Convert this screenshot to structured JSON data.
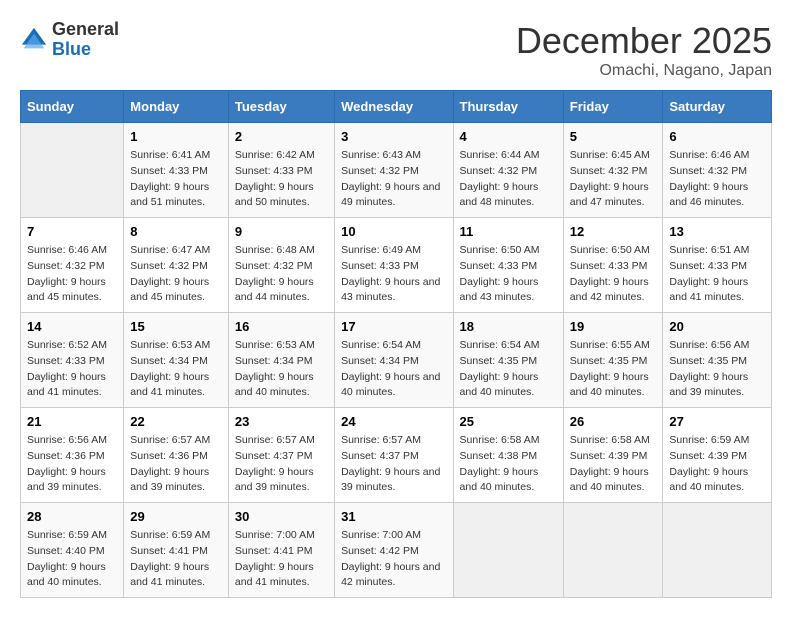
{
  "header": {
    "logo_line1": "General",
    "logo_line2": "Blue",
    "month": "December 2025",
    "location": "Omachi, Nagano, Japan"
  },
  "days_of_week": [
    "Sunday",
    "Monday",
    "Tuesday",
    "Wednesday",
    "Thursday",
    "Friday",
    "Saturday"
  ],
  "weeks": [
    [
      {
        "day": null
      },
      {
        "day": 1,
        "sunrise": "6:41 AM",
        "sunset": "4:33 PM",
        "daylight": "9 hours and 51 minutes."
      },
      {
        "day": 2,
        "sunrise": "6:42 AM",
        "sunset": "4:33 PM",
        "daylight": "9 hours and 50 minutes."
      },
      {
        "day": 3,
        "sunrise": "6:43 AM",
        "sunset": "4:32 PM",
        "daylight": "9 hours and 49 minutes."
      },
      {
        "day": 4,
        "sunrise": "6:44 AM",
        "sunset": "4:32 PM",
        "daylight": "9 hours and 48 minutes."
      },
      {
        "day": 5,
        "sunrise": "6:45 AM",
        "sunset": "4:32 PM",
        "daylight": "9 hours and 47 minutes."
      },
      {
        "day": 6,
        "sunrise": "6:46 AM",
        "sunset": "4:32 PM",
        "daylight": "9 hours and 46 minutes."
      }
    ],
    [
      {
        "day": 7,
        "sunrise": "6:46 AM",
        "sunset": "4:32 PM",
        "daylight": "9 hours and 45 minutes."
      },
      {
        "day": 8,
        "sunrise": "6:47 AM",
        "sunset": "4:32 PM",
        "daylight": "9 hours and 45 minutes."
      },
      {
        "day": 9,
        "sunrise": "6:48 AM",
        "sunset": "4:32 PM",
        "daylight": "9 hours and 44 minutes."
      },
      {
        "day": 10,
        "sunrise": "6:49 AM",
        "sunset": "4:33 PM",
        "daylight": "9 hours and 43 minutes."
      },
      {
        "day": 11,
        "sunrise": "6:50 AM",
        "sunset": "4:33 PM",
        "daylight": "9 hours and 43 minutes."
      },
      {
        "day": 12,
        "sunrise": "6:50 AM",
        "sunset": "4:33 PM",
        "daylight": "9 hours and 42 minutes."
      },
      {
        "day": 13,
        "sunrise": "6:51 AM",
        "sunset": "4:33 PM",
        "daylight": "9 hours and 41 minutes."
      }
    ],
    [
      {
        "day": 14,
        "sunrise": "6:52 AM",
        "sunset": "4:33 PM",
        "daylight": "9 hours and 41 minutes."
      },
      {
        "day": 15,
        "sunrise": "6:53 AM",
        "sunset": "4:34 PM",
        "daylight": "9 hours and 41 minutes."
      },
      {
        "day": 16,
        "sunrise": "6:53 AM",
        "sunset": "4:34 PM",
        "daylight": "9 hours and 40 minutes."
      },
      {
        "day": 17,
        "sunrise": "6:54 AM",
        "sunset": "4:34 PM",
        "daylight": "9 hours and 40 minutes."
      },
      {
        "day": 18,
        "sunrise": "6:54 AM",
        "sunset": "4:35 PM",
        "daylight": "9 hours and 40 minutes."
      },
      {
        "day": 19,
        "sunrise": "6:55 AM",
        "sunset": "4:35 PM",
        "daylight": "9 hours and 40 minutes."
      },
      {
        "day": 20,
        "sunrise": "6:56 AM",
        "sunset": "4:35 PM",
        "daylight": "9 hours and 39 minutes."
      }
    ],
    [
      {
        "day": 21,
        "sunrise": "6:56 AM",
        "sunset": "4:36 PM",
        "daylight": "9 hours and 39 minutes."
      },
      {
        "day": 22,
        "sunrise": "6:57 AM",
        "sunset": "4:36 PM",
        "daylight": "9 hours and 39 minutes."
      },
      {
        "day": 23,
        "sunrise": "6:57 AM",
        "sunset": "4:37 PM",
        "daylight": "9 hours and 39 minutes."
      },
      {
        "day": 24,
        "sunrise": "6:57 AM",
        "sunset": "4:37 PM",
        "daylight": "9 hours and 39 minutes."
      },
      {
        "day": 25,
        "sunrise": "6:58 AM",
        "sunset": "4:38 PM",
        "daylight": "9 hours and 40 minutes."
      },
      {
        "day": 26,
        "sunrise": "6:58 AM",
        "sunset": "4:39 PM",
        "daylight": "9 hours and 40 minutes."
      },
      {
        "day": 27,
        "sunrise": "6:59 AM",
        "sunset": "4:39 PM",
        "daylight": "9 hours and 40 minutes."
      }
    ],
    [
      {
        "day": 28,
        "sunrise": "6:59 AM",
        "sunset": "4:40 PM",
        "daylight": "9 hours and 40 minutes."
      },
      {
        "day": 29,
        "sunrise": "6:59 AM",
        "sunset": "4:41 PM",
        "daylight": "9 hours and 41 minutes."
      },
      {
        "day": 30,
        "sunrise": "7:00 AM",
        "sunset": "4:41 PM",
        "daylight": "9 hours and 41 minutes."
      },
      {
        "day": 31,
        "sunrise": "7:00 AM",
        "sunset": "4:42 PM",
        "daylight": "9 hours and 42 minutes."
      },
      {
        "day": null
      },
      {
        "day": null
      },
      {
        "day": null
      }
    ]
  ]
}
